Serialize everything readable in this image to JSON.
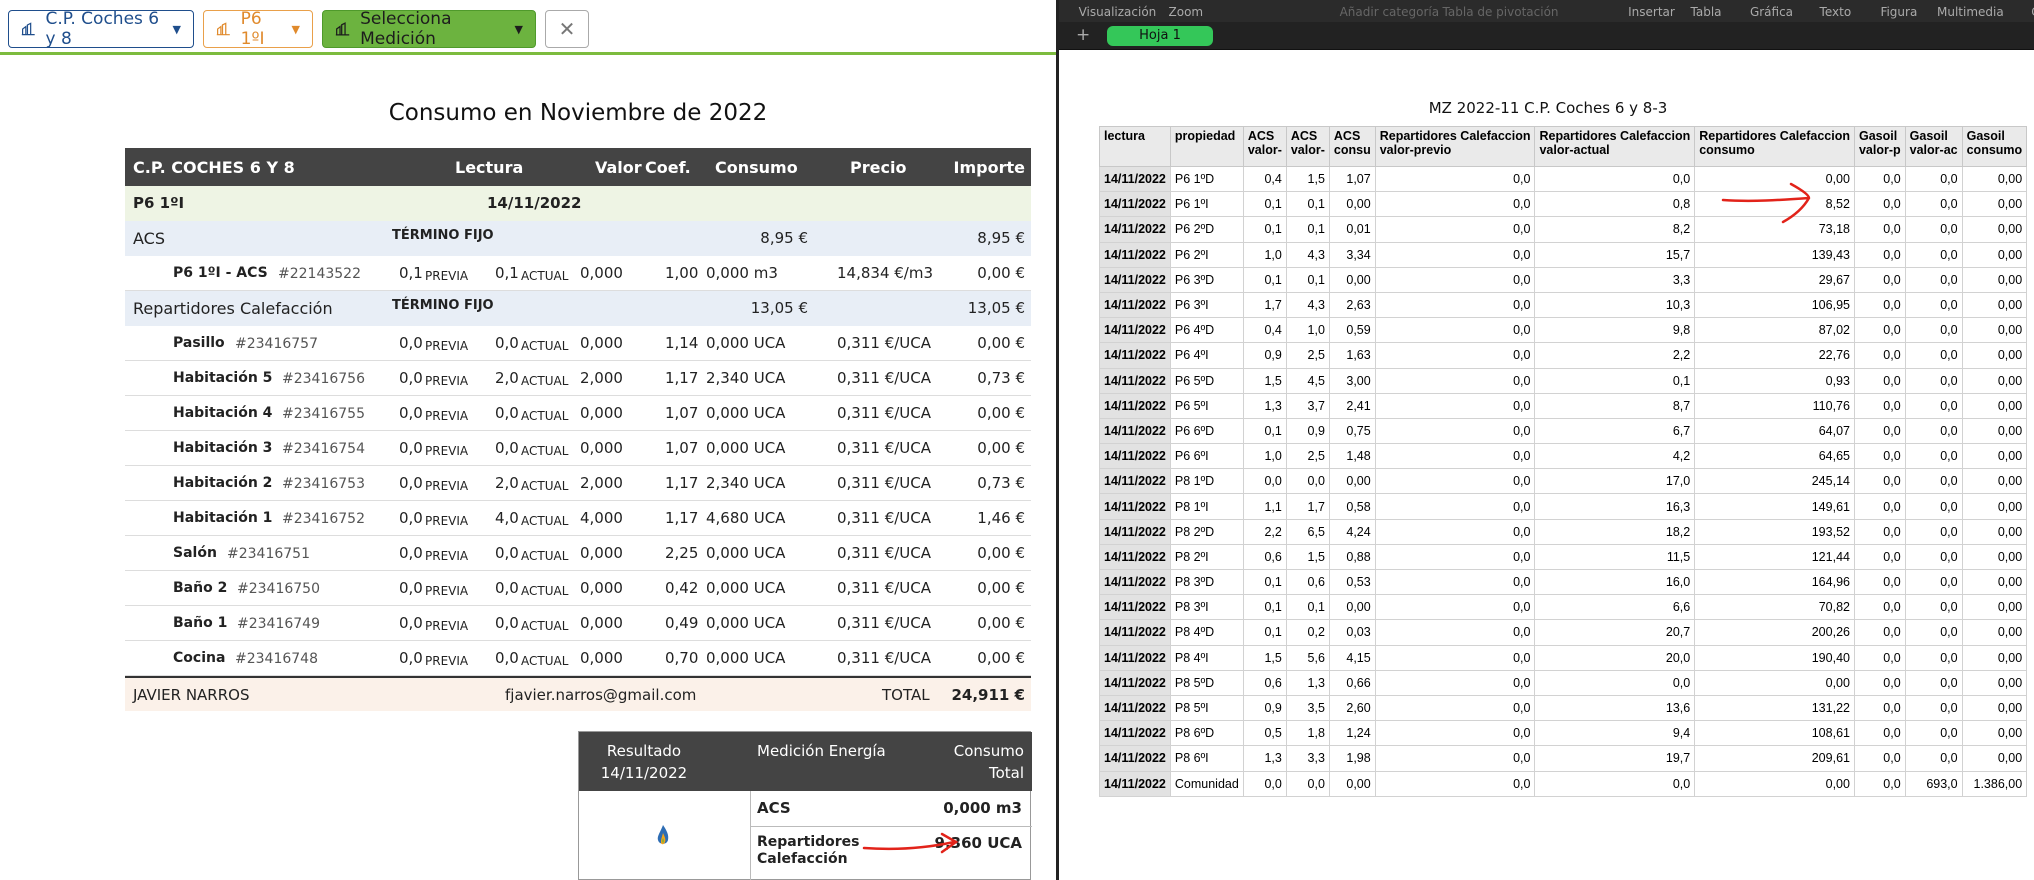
{
  "toolbar": {
    "community_label": "C.P. Coches 6 y 8",
    "property_label": "P6 1ºI",
    "measurement_label": "Selecciona Medición",
    "close_label": "✕"
  },
  "report": {
    "title": "Consumo en Noviembre de 2022",
    "headers": [
      "C.P. COCHES 6 Y 8",
      "Lectura",
      "Valor",
      "Coef.",
      "Consumo",
      "Precio",
      "Importe"
    ],
    "property_row": {
      "name": "P6 1ºI",
      "date": "14/11/2022"
    },
    "acs": {
      "label": "ACS",
      "fixed_label": "TÉRMINO FIJO",
      "fixed_value": "8,95 €",
      "total": "8,95 €"
    },
    "acs_meter": {
      "name": "P6 1ºI - ACS",
      "id": "#22143522",
      "prev": "0,1",
      "prev_label": "PREVIA",
      "curr": "0,1",
      "curr_label": "ACTUAL",
      "valor": "0,000",
      "coef": "1,00",
      "consumo": "0,000 m3",
      "precio": "14,834 €/m3",
      "importe": "0,00 €"
    },
    "heating": {
      "label": "Repartidores Calefacción",
      "fixed_label": "TÉRMINO FIJO",
      "fixed_value": "13,05 €",
      "total": "13,05 €"
    },
    "heating_meters": [
      {
        "name": "Pasillo",
        "id": "#23416757",
        "prev": "0,0",
        "curr": "0,0",
        "valor": "0,000",
        "coef": "1,14",
        "consumo": "0,000 UCA",
        "precio": "0,311 €/UCA",
        "importe": "0,00 €"
      },
      {
        "name": "Habitación 5",
        "id": "#23416756",
        "prev": "0,0",
        "curr": "2,0",
        "valor": "2,000",
        "coef": "1,17",
        "consumo": "2,340 UCA",
        "precio": "0,311 €/UCA",
        "importe": "0,73 €"
      },
      {
        "name": "Habitación 4",
        "id": "#23416755",
        "prev": "0,0",
        "curr": "0,0",
        "valor": "0,000",
        "coef": "1,07",
        "consumo": "0,000 UCA",
        "precio": "0,311 €/UCA",
        "importe": "0,00 €"
      },
      {
        "name": "Habitación 3",
        "id": "#23416754",
        "prev": "0,0",
        "curr": "0,0",
        "valor": "0,000",
        "coef": "1,07",
        "consumo": "0,000 UCA",
        "precio": "0,311 €/UCA",
        "importe": "0,00 €"
      },
      {
        "name": "Habitación 2",
        "id": "#23416753",
        "prev": "0,0",
        "curr": "2,0",
        "valor": "2,000",
        "coef": "1,17",
        "consumo": "2,340 UCA",
        "precio": "0,311 €/UCA",
        "importe": "0,73 €"
      },
      {
        "name": "Habitación 1",
        "id": "#23416752",
        "prev": "0,0",
        "curr": "4,0",
        "valor": "4,000",
        "coef": "1,17",
        "consumo": "4,680 UCA",
        "precio": "0,311 €/UCA",
        "importe": "1,46 €"
      },
      {
        "name": "Salón",
        "id": "#23416751",
        "prev": "0,0",
        "curr": "0,0",
        "valor": "0,000",
        "coef": "2,25",
        "consumo": "0,000 UCA",
        "precio": "0,311 €/UCA",
        "importe": "0,00 €"
      },
      {
        "name": "Baño 2",
        "id": "#23416750",
        "prev": "0,0",
        "curr": "0,0",
        "valor": "0,000",
        "coef": "0,42",
        "consumo": "0,000 UCA",
        "precio": "0,311 €/UCA",
        "importe": "0,00 €"
      },
      {
        "name": "Baño 1",
        "id": "#23416749",
        "prev": "0,0",
        "curr": "0,0",
        "valor": "0,000",
        "coef": "0,49",
        "consumo": "0,000 UCA",
        "precio": "0,311 €/UCA",
        "importe": "0,00 €"
      },
      {
        "name": "Cocina",
        "id": "#23416748",
        "prev": "0,0",
        "curr": "0,0",
        "valor": "0,000",
        "coef": "0,70",
        "consumo": "0,000 UCA",
        "precio": "0,311 €/UCA",
        "importe": "0,00 €"
      }
    ],
    "footer": {
      "owner": "JAVIER NARROS",
      "email": "fjavier.narros@gmail.com",
      "total_label": "TOTAL",
      "total": "24,911 €"
    }
  },
  "result": {
    "h1a": "Resultado",
    "h1b": "14/11/2022",
    "h2": "Medición Energía",
    "h3a": "Consumo",
    "h3b": "Total",
    "rows": [
      {
        "label": "ACS",
        "value": "0,000 m3"
      },
      {
        "label": "Repartidores Calefacción",
        "label_a": "Repartidores",
        "label_b": "Calefacción",
        "value": "9,360 UCA"
      }
    ]
  },
  "numbers": {
    "menu": [
      "Visualización",
      "Zoom",
      "Añadir categoría",
      "Tabla de pivotación",
      "Insertar",
      "Tabla",
      "Gráfica",
      "Texto",
      "Figura",
      "Multimedia",
      "Comentario"
    ],
    "sheet_tab": "Hoja 1",
    "add_sheet": "+",
    "table_title": "MZ 2022-11 C.P. Coches 6 y 8-3",
    "headers": [
      [
        "lectura",
        ""
      ],
      [
        "propiedad",
        ""
      ],
      [
        "ACS",
        "valor-"
      ],
      [
        "ACS",
        "valor-"
      ],
      [
        "ACS",
        "consu"
      ],
      [
        "Repartidores Calefaccion",
        "valor-previo"
      ],
      [
        "Repartidores Calefaccion",
        "valor-actual"
      ],
      [
        "Repartidores Calefaccion",
        "consumo"
      ],
      [
        "Gasoil",
        "valor-p"
      ],
      [
        "Gasoil",
        "valor-ac"
      ],
      [
        "Gasoil",
        "consumo"
      ]
    ],
    "rows": [
      [
        "14/11/2022",
        "P6 1ºD",
        "0,4",
        "1,5",
        "1,07",
        "0,0",
        "0,0",
        "0,00",
        "0,0",
        "0,0",
        "0,00"
      ],
      [
        "14/11/2022",
        "P6 1ºI",
        "0,1",
        "0,1",
        "0,00",
        "0,0",
        "0,8",
        "8,52",
        "0,0",
        "0,0",
        "0,00"
      ],
      [
        "14/11/2022",
        "P6 2ºD",
        "0,1",
        "0,1",
        "0,01",
        "0,0",
        "8,2",
        "73,18",
        "0,0",
        "0,0",
        "0,00"
      ],
      [
        "14/11/2022",
        "P6 2ºI",
        "1,0",
        "4,3",
        "3,34",
        "0,0",
        "15,7",
        "139,43",
        "0,0",
        "0,0",
        "0,00"
      ],
      [
        "14/11/2022",
        "P6 3ºD",
        "0,1",
        "0,1",
        "0,00",
        "0,0",
        "3,3",
        "29,67",
        "0,0",
        "0,0",
        "0,00"
      ],
      [
        "14/11/2022",
        "P6 3ºI",
        "1,7",
        "4,3",
        "2,63",
        "0,0",
        "10,3",
        "106,95",
        "0,0",
        "0,0",
        "0,00"
      ],
      [
        "14/11/2022",
        "P6 4ºD",
        "0,4",
        "1,0",
        "0,59",
        "0,0",
        "9,8",
        "87,02",
        "0,0",
        "0,0",
        "0,00"
      ],
      [
        "14/11/2022",
        "P6 4ºI",
        "0,9",
        "2,5",
        "1,63",
        "0,0",
        "2,2",
        "22,76",
        "0,0",
        "0,0",
        "0,00"
      ],
      [
        "14/11/2022",
        "P6 5ºD",
        "1,5",
        "4,5",
        "3,00",
        "0,0",
        "0,1",
        "0,93",
        "0,0",
        "0,0",
        "0,00"
      ],
      [
        "14/11/2022",
        "P6 5ºI",
        "1,3",
        "3,7",
        "2,41",
        "0,0",
        "8,7",
        "110,76",
        "0,0",
        "0,0",
        "0,00"
      ],
      [
        "14/11/2022",
        "P6 6ºD",
        "0,1",
        "0,9",
        "0,75",
        "0,0",
        "6,7",
        "64,07",
        "0,0",
        "0,0",
        "0,00"
      ],
      [
        "14/11/2022",
        "P6 6ºI",
        "1,0",
        "2,5",
        "1,48",
        "0,0",
        "4,2",
        "64,65",
        "0,0",
        "0,0",
        "0,00"
      ],
      [
        "14/11/2022",
        "P8 1ºD",
        "0,0",
        "0,0",
        "0,00",
        "0,0",
        "17,0",
        "245,14",
        "0,0",
        "0,0",
        "0,00"
      ],
      [
        "14/11/2022",
        "P8 1ºI",
        "1,1",
        "1,7",
        "0,58",
        "0,0",
        "16,3",
        "149,61",
        "0,0",
        "0,0",
        "0,00"
      ],
      [
        "14/11/2022",
        "P8 2ºD",
        "2,2",
        "6,5",
        "4,24",
        "0,0",
        "18,2",
        "193,52",
        "0,0",
        "0,0",
        "0,00"
      ],
      [
        "14/11/2022",
        "P8 2ºI",
        "0,6",
        "1,5",
        "0,88",
        "0,0",
        "11,5",
        "121,44",
        "0,0",
        "0,0",
        "0,00"
      ],
      [
        "14/11/2022",
        "P8 3ºD",
        "0,1",
        "0,6",
        "0,53",
        "0,0",
        "16,0",
        "164,96",
        "0,0",
        "0,0",
        "0,00"
      ],
      [
        "14/11/2022",
        "P8 3ºI",
        "0,1",
        "0,1",
        "0,00",
        "0,0",
        "6,6",
        "70,82",
        "0,0",
        "0,0",
        "0,00"
      ],
      [
        "14/11/2022",
        "P8 4ºD",
        "0,1",
        "0,2",
        "0,03",
        "0,0",
        "20,7",
        "200,26",
        "0,0",
        "0,0",
        "0,00"
      ],
      [
        "14/11/2022",
        "P8 4ºI",
        "1,5",
        "5,6",
        "4,15",
        "0,0",
        "20,0",
        "190,40",
        "0,0",
        "0,0",
        "0,00"
      ],
      [
        "14/11/2022",
        "P8 5ºD",
        "0,6",
        "1,3",
        "0,66",
        "0,0",
        "0,0",
        "0,00",
        "0,0",
        "0,0",
        "0,00"
      ],
      [
        "14/11/2022",
        "P8 5ºI",
        "0,9",
        "3,5",
        "2,60",
        "0,0",
        "13,6",
        "131,22",
        "0,0",
        "0,0",
        "0,00"
      ],
      [
        "14/11/2022",
        "P8 6ºD",
        "0,5",
        "1,8",
        "1,24",
        "0,0",
        "9,4",
        "108,61",
        "0,0",
        "0,0",
        "0,00"
      ],
      [
        "14/11/2022",
        "P8 6ºI",
        "1,3",
        "3,3",
        "1,98",
        "0,0",
        "19,7",
        "209,61",
        "0,0",
        "0,0",
        "0,00"
      ],
      [
        "14/11/2022",
        "Comunidad",
        "0,0",
        "0,0",
        "0,00",
        "0,0",
        "0,0",
        "0,00",
        "0,0",
        "693,0",
        "1.386,00"
      ]
    ]
  },
  "colors": {
    "accent_green": "#6cb33f",
    "annotation_red": "#e2231a",
    "header_dark": "#444444"
  }
}
